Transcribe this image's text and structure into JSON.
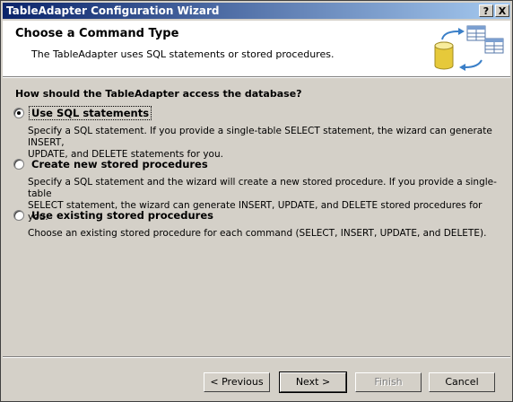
{
  "window": {
    "title": "TableAdapter Configuration Wizard",
    "help_button": "?",
    "close_button": "X"
  },
  "header": {
    "title": "Choose a Command Type",
    "subtitle": "The TableAdapter uses SQL statements or stored procedures."
  },
  "question": "How should the TableAdapter access the database?",
  "options": [
    {
      "label": "Use SQL statements",
      "checked": true,
      "description": [
        "Specify a SQL statement. If you provide a single-table SELECT statement, the wizard can generate INSERT,",
        "UPDATE, and DELETE statements for you."
      ]
    },
    {
      "label": "Create new stored procedures",
      "checked": false,
      "description": [
        "Specify a SQL statement and the wizard will create a new stored procedure. If you provide a single-table",
        "SELECT statement, the wizard can generate INSERT, UPDATE, and DELETE stored procedures for you."
      ]
    },
    {
      "label": "Use existing stored procedures",
      "checked": false,
      "description": [
        "Choose an existing stored procedure for each command (SELECT, INSERT, UPDATE, and DELETE)."
      ]
    }
  ],
  "buttons": {
    "previous": "< Previous",
    "next": "Next >",
    "finish": "Finish",
    "cancel": "Cancel"
  },
  "icons": {
    "header_icon": "database-tables-icon"
  },
  "colors": {
    "titlebar_start": "#0a246a",
    "titlebar_end": "#a6caf0",
    "dialog_face": "#d4d0c8"
  }
}
